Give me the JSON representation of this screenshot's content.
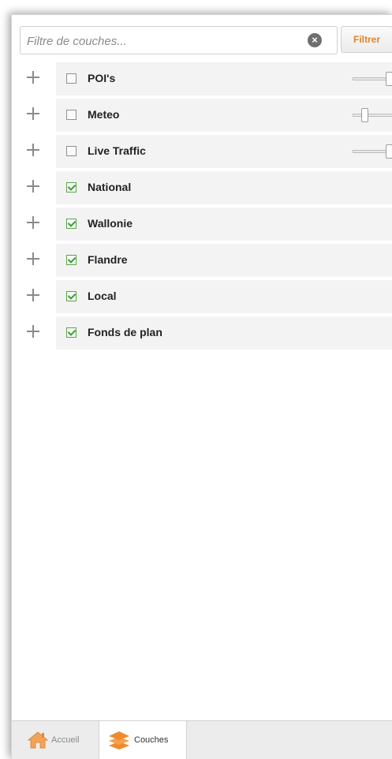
{
  "filter": {
    "placeholder": "Filtre de couches...",
    "value": "",
    "clear_icon": "clear-circle-x-icon",
    "button_label": "Filtrer"
  },
  "colors": {
    "accent": "#e0832a",
    "check_green": "#3d9a3d",
    "row_background": "#f3f3f3"
  },
  "layers": [
    {
      "label": "POI's",
      "checked": false,
      "opacity": 1.0
    },
    {
      "label": "Meteo",
      "checked": false,
      "opacity": 0.25
    },
    {
      "label": "Live Traffic",
      "checked": false,
      "opacity": 1.0
    },
    {
      "label": "National",
      "checked": true
    },
    {
      "label": "Wallonie",
      "checked": true
    },
    {
      "label": "Flandre",
      "checked": true
    },
    {
      "label": "Local",
      "checked": true
    },
    {
      "label": "Fonds de plan",
      "checked": true
    }
  ],
  "tabs": [
    {
      "label": "Accueil",
      "icon": "home-icon",
      "active": false
    },
    {
      "label": "Couches",
      "icon": "layers-icon",
      "active": true
    }
  ]
}
